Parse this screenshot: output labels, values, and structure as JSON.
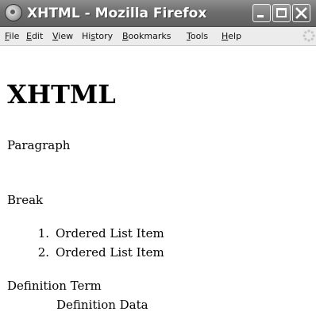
{
  "window": {
    "title": "XHTML - Mozilla Firefox"
  },
  "menubar": {
    "items": [
      {
        "access": "F",
        "rest": "ile"
      },
      {
        "access": "E",
        "rest": "dit"
      },
      {
        "access": "V",
        "rest": "iew"
      },
      {
        "pre": "Hi",
        "access": "s",
        "rest": "tory"
      },
      {
        "access": "B",
        "rest": "ookmarks"
      },
      {
        "access": "T",
        "rest": "ools"
      },
      {
        "access": "H",
        "rest": "elp"
      }
    ]
  },
  "page": {
    "heading": "XHTML",
    "paragraph": "Paragraph",
    "break_text": "Break",
    "ordered_list": [
      {
        "number": "1.",
        "text": "Ordered List Item"
      },
      {
        "number": "2.",
        "text": "Ordered List Item"
      }
    ],
    "definition_term": "Definition Term",
    "definition_data": "Definition Data"
  },
  "icons": {
    "app": "firefox-icon",
    "minimize": "minimize-icon",
    "maximize": "maximize-icon",
    "close": "close-icon",
    "throbber": "throbber-icon"
  }
}
